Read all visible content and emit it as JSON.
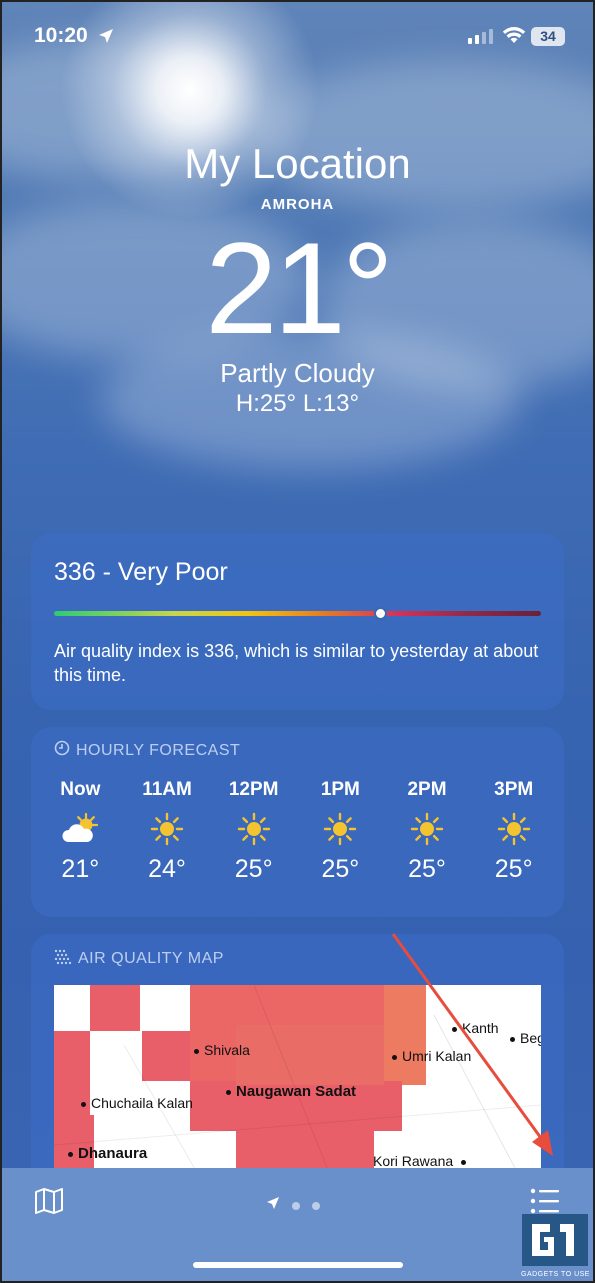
{
  "status_bar": {
    "time": "10:20",
    "battery": "34"
  },
  "header": {
    "title": "My Location",
    "subtitle": "AMROHA",
    "temperature": "21°",
    "condition": "Partly Cloudy",
    "high_low": "H:25°  L:13°"
  },
  "air_quality": {
    "title": "336 - Very Poor",
    "description": "Air quality index is 336, which is similar to yesterday at about this time.",
    "level_fraction": 0.67
  },
  "hourly": {
    "heading": "HOURLY FORECAST",
    "items": [
      {
        "time": "Now",
        "icon": "partly-cloudy-icon",
        "temp": "21°"
      },
      {
        "time": "11AM",
        "icon": "sun-icon",
        "temp": "24°"
      },
      {
        "time": "12PM",
        "icon": "sun-icon",
        "temp": "25°"
      },
      {
        "time": "1PM",
        "icon": "sun-icon",
        "temp": "25°"
      },
      {
        "time": "2PM",
        "icon": "sun-icon",
        "temp": "25°"
      },
      {
        "time": "3PM",
        "icon": "sun-icon",
        "temp": "25°"
      }
    ]
  },
  "air_map": {
    "heading": "AIR QUALITY MAP",
    "places": [
      "Shivala",
      "Chuchaila Kalan",
      "Naugawan Sadat",
      "Umri Kalan",
      "Kanth",
      "Beg",
      "Dhanaura",
      "Kori Rawana"
    ]
  },
  "watermark": {
    "text": "GADGETS TO USE"
  },
  "colors": {
    "aqi_pin": "#ffffff",
    "annotation_arrow": "#e74c3c"
  }
}
